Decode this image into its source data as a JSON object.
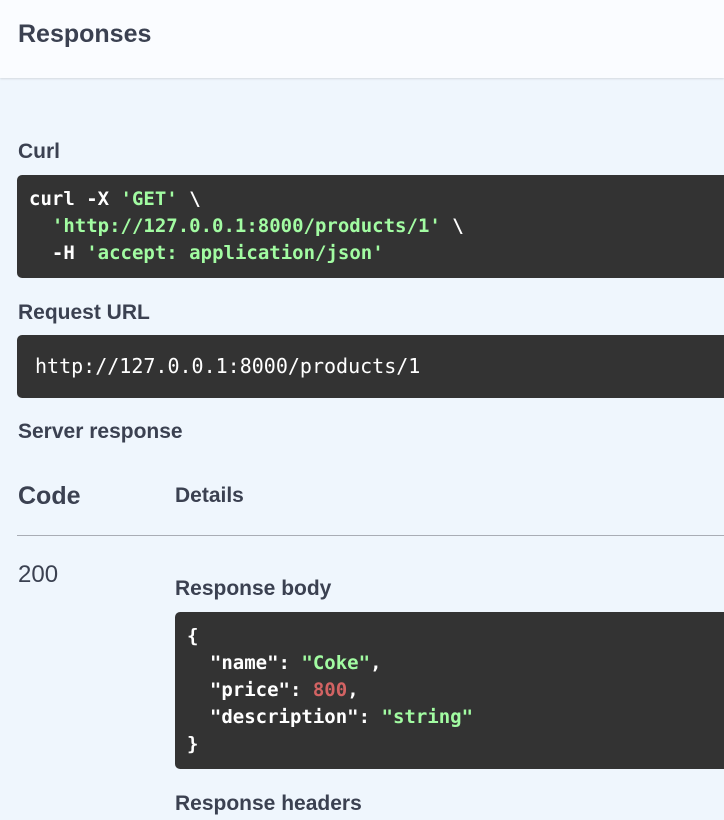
{
  "header": {
    "title": "Responses"
  },
  "curl": {
    "label": "Curl",
    "cmd": "curl -X",
    "method": "'GET'",
    "cont": "\\",
    "indent": "  ",
    "url": "'http://127.0.0.1:8000/products/1'",
    "h_flag": "-H",
    "header_value": "'accept: application/json'"
  },
  "request_url": {
    "label": "Request URL",
    "value": "http://127.0.0.1:8000/products/1"
  },
  "server_response": {
    "label": "Server response",
    "col_code": "Code",
    "col_details": "Details",
    "status_code": "200",
    "response_body": {
      "label": "Response body",
      "open": "{",
      "close": "}",
      "name_key": "\"name\"",
      "name_value": "\"Coke\"",
      "price_key": "\"price\"",
      "price_value": "800",
      "description_key": "\"description\"",
      "description_value": "\"string\""
    },
    "response_headers_label": "Response headers"
  }
}
